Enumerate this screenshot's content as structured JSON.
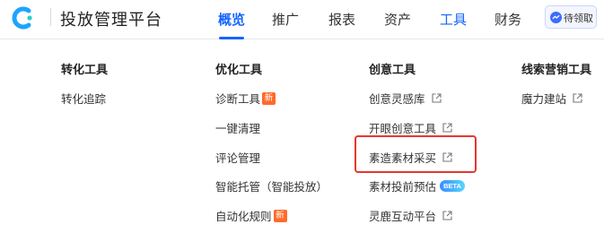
{
  "header": {
    "title": "投放管理平台",
    "nav": [
      "概览",
      "推广",
      "报表",
      "资产",
      "工具",
      "财务"
    ],
    "active_nav": "概览",
    "badge_button": "待领取"
  },
  "menu": {
    "columns": [
      {
        "heading": "转化工具",
        "items": [
          {
            "label": "转化追踪"
          }
        ]
      },
      {
        "heading": "优化工具",
        "items": [
          {
            "label": "诊断工具",
            "tag": "新"
          },
          {
            "label": "一键清理"
          },
          {
            "label": "评论管理"
          },
          {
            "label": "智能托管（智能投放）"
          },
          {
            "label": "自动化规则",
            "tag": "新"
          }
        ]
      },
      {
        "heading": "创意工具",
        "items": [
          {
            "label": "创意灵感库",
            "external": true
          },
          {
            "label": "开眼创意工具",
            "external": true
          },
          {
            "label": "素造素材采买",
            "external": true,
            "highlighted": true
          },
          {
            "label": "素材投前预估",
            "tag": "BETA"
          },
          {
            "label": "灵鹿互动平台",
            "external": true
          }
        ]
      },
      {
        "heading": "线索营销工具",
        "items": [
          {
            "label": "魔力建站",
            "external": true
          }
        ]
      }
    ]
  },
  "colors": {
    "accent": "#1664ff",
    "new_tag": "#ff6a2a",
    "highlight_box": "#e8352e"
  },
  "icons": {
    "logo": "brand-logo-icon",
    "external": "external-link-icon",
    "badge": "message-icon"
  }
}
